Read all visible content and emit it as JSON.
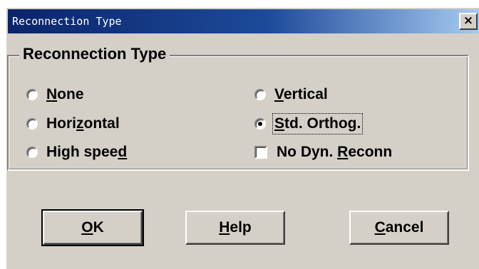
{
  "window": {
    "title": "Reconnection Type",
    "close_label": "×"
  },
  "group": {
    "legend": "Reconnection Type"
  },
  "options": {
    "none": {
      "pre": "",
      "key": "N",
      "post": "one",
      "selected": false
    },
    "horizontal": {
      "pre": "Hori",
      "key": "z",
      "post": "ontal",
      "selected": false
    },
    "high_speed": {
      "pre": "High spee",
      "key": "d",
      "post": "",
      "selected": false
    },
    "vertical": {
      "pre": "",
      "key": "V",
      "post": "ertical",
      "selected": false
    },
    "std_orthog": {
      "pre": "",
      "key": "S",
      "post": "td. Orthog.",
      "selected": true
    }
  },
  "checkbox": {
    "no_dyn_reconn": {
      "pre": "No Dyn. ",
      "key": "R",
      "post": "econn",
      "checked": false
    }
  },
  "buttons": {
    "ok": {
      "pre": "",
      "key": "O",
      "post": "K"
    },
    "help": {
      "pre": "",
      "key": "H",
      "post": "elp"
    },
    "cancel": {
      "pre": "",
      "key": "C",
      "post": "ancel"
    }
  }
}
